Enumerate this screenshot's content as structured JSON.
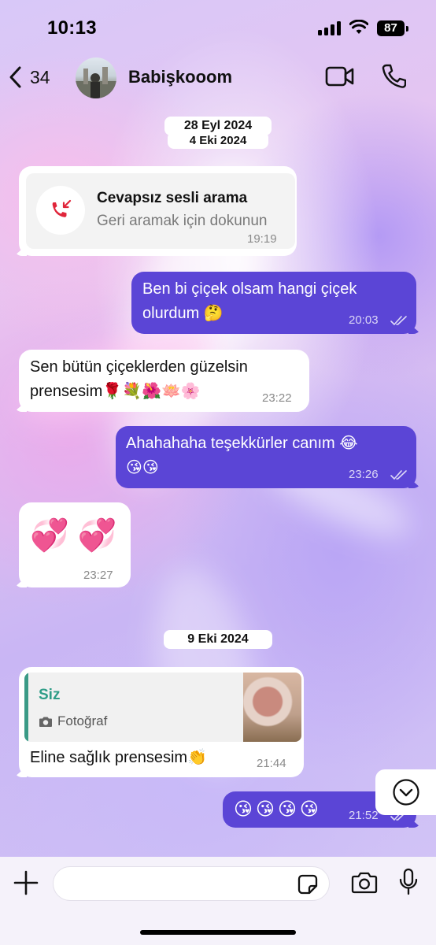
{
  "status_bar": {
    "time": "10:13",
    "battery": "87"
  },
  "header": {
    "back_count": "34",
    "contact_name": "Babişkooom"
  },
  "dates": {
    "first": "28 Eyl 2024",
    "second": "4 Eki 2024",
    "third": "9 Eki 2024"
  },
  "missed_call": {
    "title": "Cevapsız sesli arama",
    "subtitle": "Geri aramak için dokunun",
    "time": "19:19"
  },
  "messages": [
    {
      "direction": "out",
      "line1": "Ben bi çiçek olsam hangi çiçek",
      "line2": "olurdum 🤔",
      "time": "20:03"
    },
    {
      "direction": "in",
      "line1": "Sen bütün çiçeklerden güzelsin",
      "line2": "prensesim🌹💐🌺🪷🌸",
      "time": "23:22"
    },
    {
      "direction": "out",
      "line1": "Ahahahaha teşekkürler canım 😂",
      "line2": "😘😘",
      "time": "23:26"
    },
    {
      "direction": "in",
      "line1": "💞 💞",
      "time": "23:27"
    },
    {
      "direction": "in",
      "quote_author": "Siz",
      "quote_type": "Fotoğraf",
      "line1": "Eline sağlık prensesim👏",
      "time": "21:44"
    },
    {
      "direction": "out",
      "line1": "😘😘😘😘",
      "time": "21:52"
    }
  ],
  "icons": [
    "back-chevron",
    "video-call",
    "phone",
    "missed-call",
    "camera",
    "chevron-down",
    "plus",
    "sticker",
    "microphone",
    "double-check"
  ],
  "colors": {
    "outgoing_bubble": "#5b45d6",
    "incoming_bubble": "#ffffff",
    "missed_call_red": "#e0253a",
    "quote_author": "#2e9d87"
  }
}
